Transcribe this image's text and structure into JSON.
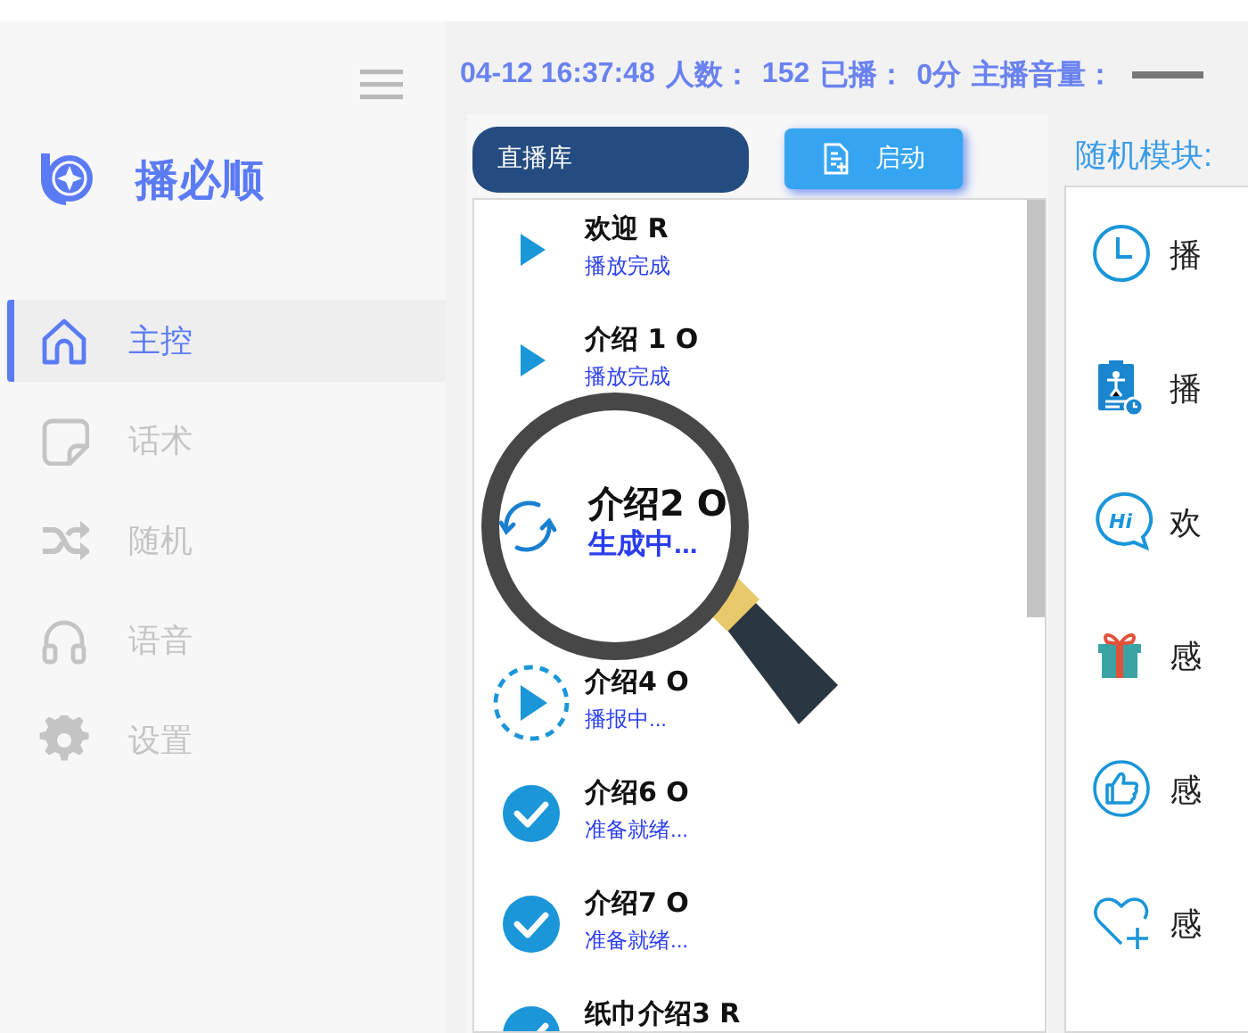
{
  "sidebar": {
    "app_name": "播必顺",
    "items": [
      {
        "label": "主控",
        "selected": true
      },
      {
        "label": "话术",
        "selected": false
      },
      {
        "label": "随机",
        "selected": false
      },
      {
        "label": "语音",
        "selected": false
      },
      {
        "label": "设置",
        "selected": false
      }
    ]
  },
  "header": [
    "04-12 16:37:48",
    "人数：",
    "152",
    "已播：",
    "0分",
    "主播音量："
  ],
  "library": {
    "tab": "直播库",
    "start_button": "启动",
    "items": [
      {
        "title": "欢迎 R",
        "status": "播放完成",
        "kind": "play",
        "magnified": false
      },
      {
        "title": "介绍 1 O",
        "status": "播放完成",
        "kind": "play",
        "magnified": false
      },
      {
        "title": "介绍2 O",
        "status": "生成中...",
        "kind": "generating",
        "magnified": true
      },
      {
        "title": "介绍4 O",
        "status": "播报中...",
        "kind": "playing",
        "magnified": false
      },
      {
        "title": "介绍6 O",
        "status": "准备就绪...",
        "kind": "ready",
        "magnified": false
      },
      {
        "title": "介绍7 O",
        "status": "准备就绪...",
        "kind": "ready",
        "magnified": false
      },
      {
        "title": "纸巾介绍3 R",
        "kind": "ready",
        "magnified": false
      }
    ]
  },
  "random_module": {
    "title": "随机模块:",
    "items": [
      {
        "label": "播"
      },
      {
        "label": "播"
      },
      {
        "label": "欢",
        "icon_text": "Hi"
      },
      {
        "label": "感"
      },
      {
        "label": "感"
      },
      {
        "label": "感"
      }
    ]
  }
}
